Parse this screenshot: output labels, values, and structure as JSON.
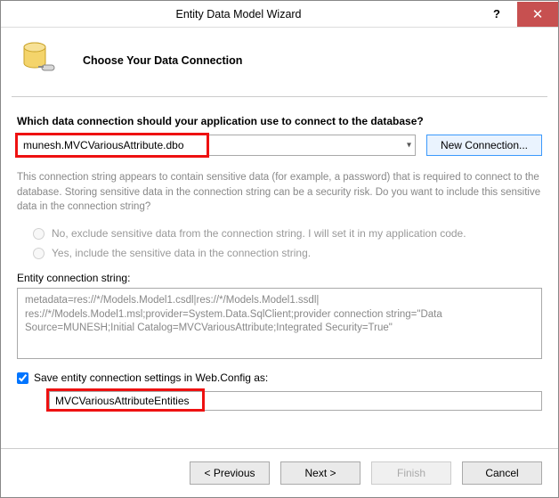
{
  "window": {
    "title": "Entity Data Model Wizard",
    "help_glyph": "?",
    "close_glyph": "✕"
  },
  "header": {
    "step_title": "Choose Your Data Connection"
  },
  "main": {
    "question": "Which data connection should your application use to connect to the database?",
    "connection_value": "munesh.MVCVariousAttribute.dbo",
    "new_connection_label": "New Connection...",
    "sensitive_desc": "This connection string appears to contain sensitive data (for example, a password) that is required to connect to the database. Storing sensitive data in the connection string can be a security risk. Do you want to include this sensitive data in the connection string?",
    "radio_no": "No, exclude sensitive data from the connection string. I will set it in my application code.",
    "radio_yes": "Yes, include the sensitive data in the connection string.",
    "conn_string_label": "Entity connection string:",
    "conn_string_value": "metadata=res://*/Models.Model1.csdl|res://*/Models.Model1.ssdl|\nres://*/Models.Model1.msl;provider=System.Data.SqlClient;provider connection string=\"Data Source=MUNESH;Initial Catalog=MVCVariousAttribute;Integrated Security=True\"",
    "save_check_label": "Save entity connection settings in Web.Config as:",
    "save_name_value": "MVCVariousAttributeEntities"
  },
  "footer": {
    "previous": "< Previous",
    "next": "Next >",
    "finish": "Finish",
    "cancel": "Cancel"
  }
}
